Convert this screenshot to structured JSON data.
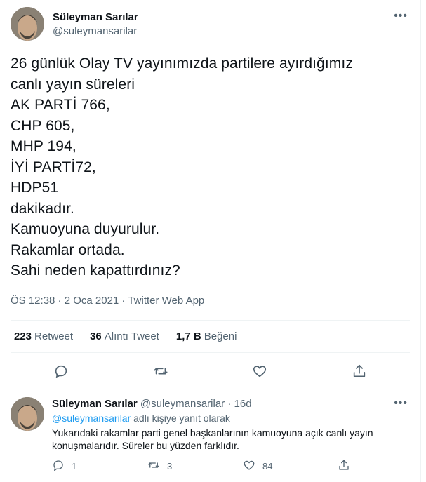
{
  "tweet": {
    "author_name": "Süleyman Sarılar",
    "author_handle": "@suleymansarilar",
    "lines": [
      "26 günlük Olay TV yayınımızda partilere ayırdığımız",
      "canlı yayın süreleri",
      "AK PARTİ 766,",
      "CHP 605,",
      "MHP 194,",
      "İYİ PARTİ72,",
      "HDP51",
      "dakikadır.",
      "Kamuoyuna duyurulur.",
      "Rakamlar ortada.",
      "Sahi neden kapattırdınız?"
    ],
    "meta": "ÖS 12:38 · 2 Oca 2021 · Twitter Web App",
    "stats": {
      "retweets_count": "223",
      "retweets_label": "Retweet",
      "quotes_count": "36",
      "quotes_label": "Alıntı Tweet",
      "likes_count": "1,7 B",
      "likes_label": "Beğeni"
    },
    "more_icon": "more-icon",
    "accent_color": "#1d9bf0"
  },
  "reply": {
    "author_name": "Süleyman Sarılar",
    "author_handle": "@suleymansarilar",
    "time": "16d",
    "replying_mention": "@suleymansarilar",
    "replying_suffix": "adlı kişiye yanıt olarak",
    "text": "Yukarıdaki rakamlar parti genel başkanlarının kamuoyuna açık canlı yayın konuşmalarıdır. Süreler bu yüzden farklıdır.",
    "reply_count": "1",
    "retweet_count": "3",
    "like_count": "84"
  }
}
